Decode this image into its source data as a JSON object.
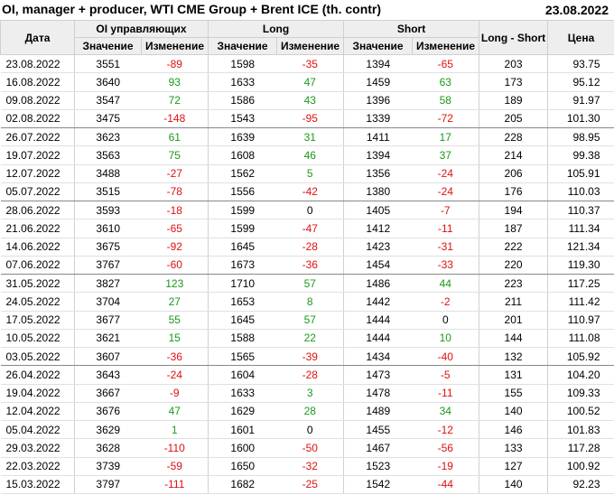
{
  "title": "OI, manager + producer, WTI CME Group + Brent ICE (th. contr)",
  "report_date": "23.08.2022",
  "colors": {
    "positive": "#1a9a1a",
    "negative": "#e01010",
    "header_bg": "#eeeeee"
  },
  "headers": {
    "date": "Дата",
    "oi_group": "OI управляющих",
    "long_group": "Long",
    "short_group": "Short",
    "long_short": "Long - Short",
    "price": "Цена",
    "value": "Значение",
    "change": "Изменение"
  },
  "rows": [
    {
      "date": "23.08.2022",
      "oi": "3551",
      "oi_chg": "-89",
      "long": "1598",
      "long_chg": "-35",
      "short": "1394",
      "short_chg": "-65",
      "ls": "203",
      "price": "93.75",
      "month_end": false
    },
    {
      "date": "16.08.2022",
      "oi": "3640",
      "oi_chg": "93",
      "long": "1633",
      "long_chg": "47",
      "short": "1459",
      "short_chg": "63",
      "ls": "173",
      "price": "95.12",
      "month_end": false
    },
    {
      "date": "09.08.2022",
      "oi": "3547",
      "oi_chg": "72",
      "long": "1586",
      "long_chg": "43",
      "short": "1396",
      "short_chg": "58",
      "ls": "189",
      "price": "91.97",
      "month_end": false
    },
    {
      "date": "02.08.2022",
      "oi": "3475",
      "oi_chg": "-148",
      "long": "1543",
      "long_chg": "-95",
      "short": "1339",
      "short_chg": "-72",
      "ls": "205",
      "price": "101.30",
      "month_end": true
    },
    {
      "date": "26.07.2022",
      "oi": "3623",
      "oi_chg": "61",
      "long": "1639",
      "long_chg": "31",
      "short": "1411",
      "short_chg": "17",
      "ls": "228",
      "price": "98.95",
      "month_end": false
    },
    {
      "date": "19.07.2022",
      "oi": "3563",
      "oi_chg": "75",
      "long": "1608",
      "long_chg": "46",
      "short": "1394",
      "short_chg": "37",
      "ls": "214",
      "price": "99.38",
      "month_end": false
    },
    {
      "date": "12.07.2022",
      "oi": "3488",
      "oi_chg": "-27",
      "long": "1562",
      "long_chg": "5",
      "short": "1356",
      "short_chg": "-24",
      "ls": "206",
      "price": "105.91",
      "month_end": false
    },
    {
      "date": "05.07.2022",
      "oi": "3515",
      "oi_chg": "-78",
      "long": "1556",
      "long_chg": "-42",
      "short": "1380",
      "short_chg": "-24",
      "ls": "176",
      "price": "110.03",
      "month_end": true
    },
    {
      "date": "28.06.2022",
      "oi": "3593",
      "oi_chg": "-18",
      "long": "1599",
      "long_chg": "0",
      "short": "1405",
      "short_chg": "-7",
      "ls": "194",
      "price": "110.37",
      "month_end": false
    },
    {
      "date": "21.06.2022",
      "oi": "3610",
      "oi_chg": "-65",
      "long": "1599",
      "long_chg": "-47",
      "short": "1412",
      "short_chg": "-11",
      "ls": "187",
      "price": "111.34",
      "month_end": false
    },
    {
      "date": "14.06.2022",
      "oi": "3675",
      "oi_chg": "-92",
      "long": "1645",
      "long_chg": "-28",
      "short": "1423",
      "short_chg": "-31",
      "ls": "222",
      "price": "121.34",
      "month_end": false
    },
    {
      "date": "07.06.2022",
      "oi": "3767",
      "oi_chg": "-60",
      "long": "1673",
      "long_chg": "-36",
      "short": "1454",
      "short_chg": "-33",
      "ls": "220",
      "price": "119.30",
      "month_end": true
    },
    {
      "date": "31.05.2022",
      "oi": "3827",
      "oi_chg": "123",
      "long": "1710",
      "long_chg": "57",
      "short": "1486",
      "short_chg": "44",
      "ls": "223",
      "price": "117.25",
      "month_end": false
    },
    {
      "date": "24.05.2022",
      "oi": "3704",
      "oi_chg": "27",
      "long": "1653",
      "long_chg": "8",
      "short": "1442",
      "short_chg": "-2",
      "ls": "211",
      "price": "111.42",
      "month_end": false
    },
    {
      "date": "17.05.2022",
      "oi": "3677",
      "oi_chg": "55",
      "long": "1645",
      "long_chg": "57",
      "short": "1444",
      "short_chg": "0",
      "ls": "201",
      "price": "110.97",
      "month_end": false
    },
    {
      "date": "10.05.2022",
      "oi": "3621",
      "oi_chg": "15",
      "long": "1588",
      "long_chg": "22",
      "short": "1444",
      "short_chg": "10",
      "ls": "144",
      "price": "111.08",
      "month_end": false
    },
    {
      "date": "03.05.2022",
      "oi": "3607",
      "oi_chg": "-36",
      "long": "1565",
      "long_chg": "-39",
      "short": "1434",
      "short_chg": "-40",
      "ls": "132",
      "price": "105.92",
      "month_end": true
    },
    {
      "date": "26.04.2022",
      "oi": "3643",
      "oi_chg": "-24",
      "long": "1604",
      "long_chg": "-28",
      "short": "1473",
      "short_chg": "-5",
      "ls": "131",
      "price": "104.20",
      "month_end": false
    },
    {
      "date": "19.04.2022",
      "oi": "3667",
      "oi_chg": "-9",
      "long": "1633",
      "long_chg": "3",
      "short": "1478",
      "short_chg": "-11",
      "ls": "155",
      "price": "109.33",
      "month_end": false
    },
    {
      "date": "12.04.2022",
      "oi": "3676",
      "oi_chg": "47",
      "long": "1629",
      "long_chg": "28",
      "short": "1489",
      "short_chg": "34",
      "ls": "140",
      "price": "100.52",
      "month_end": false
    },
    {
      "date": "05.04.2022",
      "oi": "3629",
      "oi_chg": "1",
      "long": "1601",
      "long_chg": "0",
      "short": "1455",
      "short_chg": "-12",
      "ls": "146",
      "price": "101.83",
      "month_end": false
    },
    {
      "date": "29.03.2022",
      "oi": "3628",
      "oi_chg": "-110",
      "long": "1600",
      "long_chg": "-50",
      "short": "1467",
      "short_chg": "-56",
      "ls": "133",
      "price": "117.28",
      "month_end": false
    },
    {
      "date": "22.03.2022",
      "oi": "3739",
      "oi_chg": "-59",
      "long": "1650",
      "long_chg": "-32",
      "short": "1523",
      "short_chg": "-19",
      "ls": "127",
      "price": "100.92",
      "month_end": false
    },
    {
      "date": "15.03.2022",
      "oi": "3797",
      "oi_chg": "-111",
      "long": "1682",
      "long_chg": "-25",
      "short": "1542",
      "short_chg": "-44",
      "ls": "140",
      "price": "92.23",
      "month_end": false
    }
  ]
}
